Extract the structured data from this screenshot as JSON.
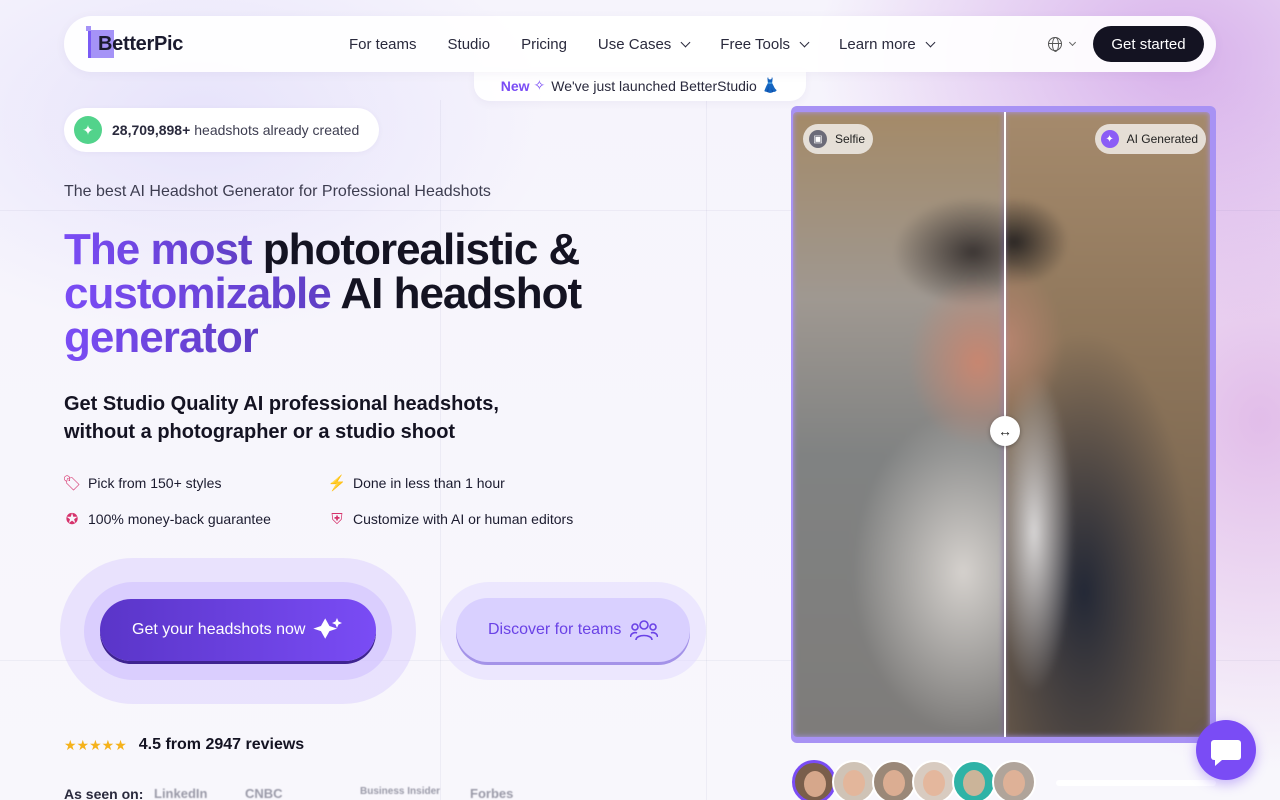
{
  "brand": {
    "name": "BetterPic"
  },
  "nav": {
    "links": [
      {
        "label": "For teams",
        "dropdown": false
      },
      {
        "label": "Studio",
        "dropdown": false
      },
      {
        "label": "Pricing",
        "dropdown": false
      },
      {
        "label": "Use Cases",
        "dropdown": true
      },
      {
        "label": "Free Tools",
        "dropdown": true
      },
      {
        "label": "Learn more",
        "dropdown": true
      }
    ],
    "cta_label": "Get started"
  },
  "announcement": {
    "badge": "New",
    "text": "We've just launched BetterStudio"
  },
  "counter": {
    "number": "28,709,898+",
    "text": "headshots already created"
  },
  "hero": {
    "subhead": "The best AI Headshot Generator for Professional Headshots",
    "headline_part1": "The most",
    "headline_part2": " photorealistic &",
    "headline_part3": "customizable",
    "headline_part4": " AI headshot",
    "headline_part5": "generator",
    "lead_line1": "Get Studio Quality AI professional headshots,",
    "lead_line2": "without a photographer or a studio shoot"
  },
  "features": [
    "Pick from 150+ styles",
    "Done in less than 1 hour",
    "100% money-back guarantee",
    "Customize with AI or human editors"
  ],
  "cta": {
    "primary": "Get your headshots now",
    "secondary": "Discover for teams"
  },
  "rating": {
    "stars": 4.5,
    "text": "4.5 from 2947 reviews"
  },
  "press": {
    "label": "As seen on:",
    "outlets": [
      "LinkedIn",
      "CNBC",
      "Business Insider",
      "Forbes"
    ]
  },
  "compare": {
    "left_tag": "Selfie",
    "right_tag": "AI Generated",
    "split_fraction": 0.5
  },
  "colors": {
    "accent": "#7a4cf5",
    "dark": "#141322",
    "star": "#f5b21b"
  }
}
